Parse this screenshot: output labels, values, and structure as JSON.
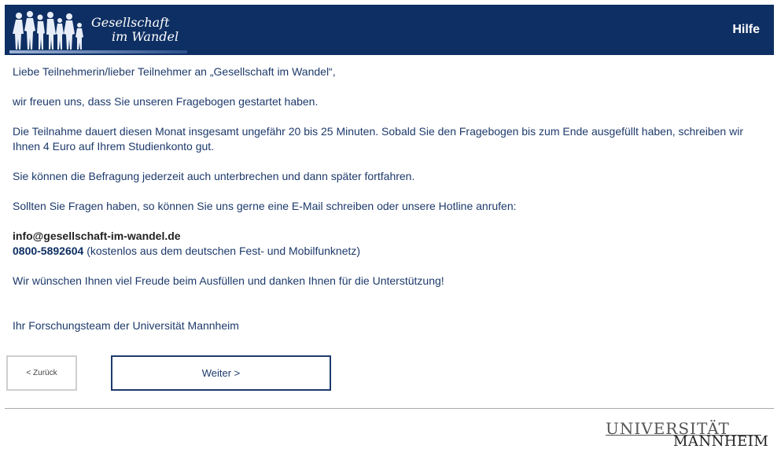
{
  "header": {
    "logo_line1": "Gesellschaft",
    "logo_line2": "im Wandel",
    "help_label": "Hilfe"
  },
  "content": {
    "greeting": "Liebe Teilnehmerin/lieber Teilnehmer an „Gesellschaft im Wandel“,",
    "para1": "wir freuen uns, dass Sie unseren Fragebogen gestartet haben.",
    "para2": "Die Teilnahme dauert diesen Monat insgesamt ungefähr 20 bis 25 Minuten. Sobald Sie den Fragebogen bis zum Ende ausgefüllt haben, schreiben wir Ihnen 4 Euro auf Ihrem Studienkonto gut.",
    "para3": "Sie können die Befragung jederzeit auch unterbrechen und dann später fortfahren.",
    "para4": "Sollten Sie Fragen haben, so können Sie uns gerne eine E-Mail schreiben oder unsere Hotline anrufen:",
    "email": "info@gesellschaft-im-wandel.de",
    "phone": "0800-5892604",
    "phone_note": " (kostenlos aus dem deutschen Fest- und Mobilfunknetz)",
    "para5": "Wir wünschen Ihnen viel Freude beim Ausfüllen und danken Ihnen für die Unterstützung!",
    "signature": "Ihr Forschungsteam der Universität Mannheim"
  },
  "buttons": {
    "back_label": "< Zurück",
    "next_label": "Weiter >"
  },
  "footer": {
    "uni_line1": "UNIVERSITÄT",
    "uni_line2": "MANNHEIM"
  },
  "colors": {
    "header_bg": "#0e2f63",
    "text": "#1d3a6b"
  }
}
